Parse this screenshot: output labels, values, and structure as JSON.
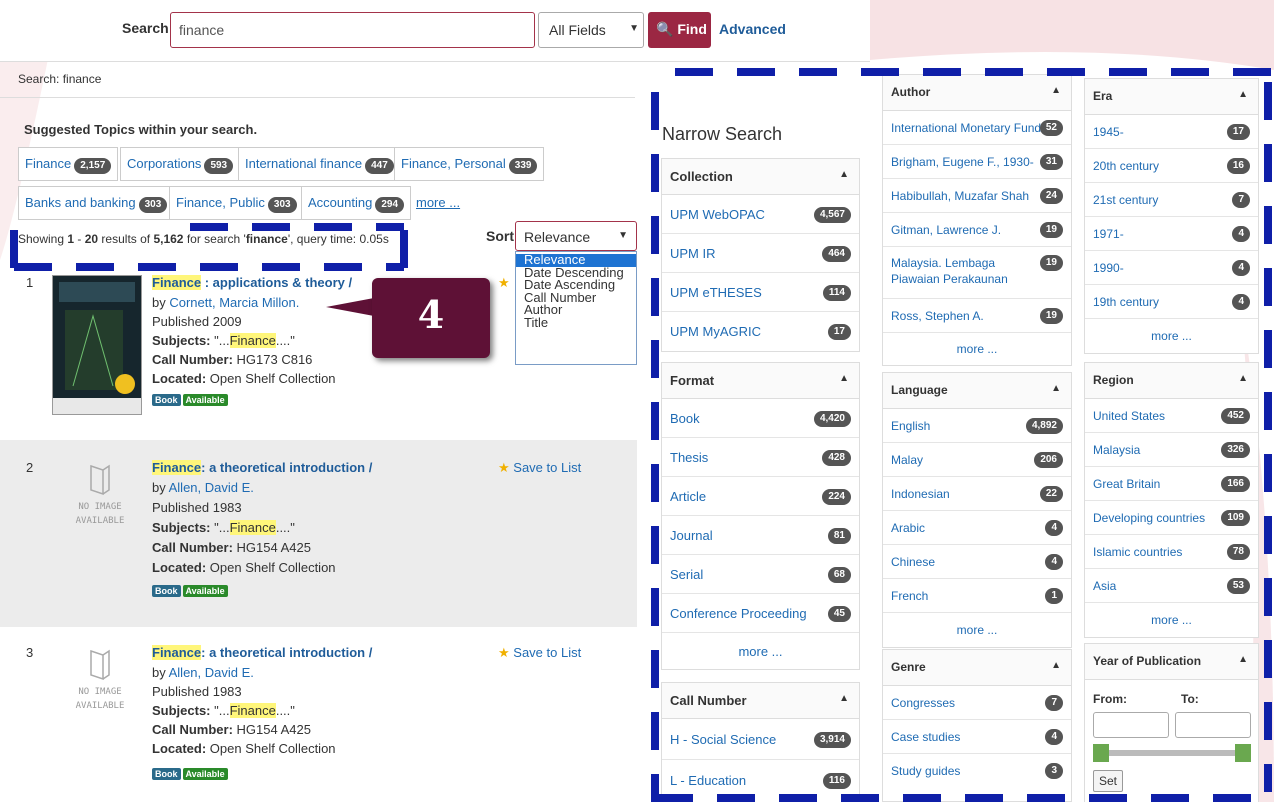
{
  "search": {
    "label": "Search:",
    "value": "finance",
    "field": "All Fields",
    "find": "Find",
    "advanced": "Advanced"
  },
  "breadcrumb": "Search: finance",
  "suggested": {
    "title": "Suggested Topics within your search.",
    "topics": [
      {
        "label": "Finance",
        "count": "2,157"
      },
      {
        "label": "Corporations",
        "count": "593"
      },
      {
        "label": "International finance",
        "count": "447"
      },
      {
        "label": "Finance, Personal",
        "count": "339"
      },
      {
        "label": "Banks and banking",
        "count": "303"
      },
      {
        "label": "Finance, Public",
        "count": "303"
      },
      {
        "label": "Accounting",
        "count": "294"
      }
    ],
    "more": "more ..."
  },
  "showing": {
    "pre": "Showing ",
    "from": "1",
    "mid1": " - ",
    "to": "20",
    "mid2": " results of ",
    "total": "5,162",
    "mid3": " for search '",
    "query": "finance",
    "post": "', query time: 0.05s"
  },
  "sort": {
    "label": "Sort",
    "selected": "Relevance",
    "options": [
      "Relevance",
      "Date Descending",
      "Date Ascending",
      "Call Number",
      "Author",
      "Title"
    ]
  },
  "callout": "4",
  "results": [
    {
      "num": "1",
      "title_hl": "Finance",
      "title_rest": " : applications & theory /",
      "by": "by ",
      "author": "Cornett, Marcia Millon.",
      "published": "Published 2009",
      "subjects_label": "Subjects:",
      "subj_pre": " \"...",
      "subj_hl": "Finance",
      "subj_post": "....\"",
      "call_label": "Call Number:",
      "call": " HG173 C816",
      "loc_label": "Located:",
      "loc": " Open Shelf Collection",
      "tag1": "Book",
      "tag2": "Available",
      "save": ""
    },
    {
      "num": "2",
      "title_hl": "Finance",
      "title_rest": ": a theoretical introduction /",
      "by": "by ",
      "author": "Allen, David E.",
      "published": "Published 1983",
      "subjects_label": "Subjects:",
      "subj_pre": " \"...",
      "subj_hl": "Finance",
      "subj_post": "....\"",
      "call_label": "Call Number:",
      "call": " HG154 A425",
      "loc_label": "Located:",
      "loc": " Open Shelf Collection",
      "tag1": "Book",
      "tag2": "Available",
      "save": "Save to List",
      "noimg": "NO IMAGE AVAILABLE"
    },
    {
      "num": "3",
      "title_hl": "Finance",
      "title_rest": ": a theoretical introduction /",
      "by": "by ",
      "author": "Allen, David E.",
      "published": "Published 1983",
      "subjects_label": "Subjects:",
      "subj_pre": " \"...",
      "subj_hl": "Finance",
      "subj_post": "....\"",
      "call_label": "Call Number:",
      "call": " HG154 A425",
      "loc_label": "Located:",
      "loc": " Open Shelf Collection",
      "tag1": "Book",
      "tag2": "Available",
      "save": "Save to List",
      "noimg": "NO IMAGE AVAILABLE"
    }
  ],
  "narrow": "Narrow Search",
  "facets": {
    "collection": {
      "title": "Collection",
      "items": [
        {
          "label": "UPM WebOPAC",
          "count": "4,567"
        },
        {
          "label": "UPM IR",
          "count": "464"
        },
        {
          "label": "UPM eTHESES",
          "count": "114"
        },
        {
          "label": "UPM MyAGRIC",
          "count": "17"
        }
      ]
    },
    "format": {
      "title": "Format",
      "items": [
        {
          "label": "Book",
          "count": "4,420"
        },
        {
          "label": "Thesis",
          "count": "428"
        },
        {
          "label": "Article",
          "count": "224"
        },
        {
          "label": "Journal",
          "count": "81"
        },
        {
          "label": "Serial",
          "count": "68"
        },
        {
          "label": "Conference Proceeding",
          "count": "45"
        }
      ],
      "more": "more ..."
    },
    "callnumber": {
      "title": "Call Number",
      "items": [
        {
          "label": "H - Social Science",
          "count": "3,914"
        },
        {
          "label": "L - Education",
          "count": "116"
        }
      ]
    },
    "author": {
      "title": "Author",
      "items": [
        {
          "label": "International Monetary Fund",
          "count": "52"
        },
        {
          "label": "Brigham, Eugene F., 1930-",
          "count": "31"
        },
        {
          "label": "Habibullah, Muzafar Shah",
          "count": "24"
        },
        {
          "label": "Gitman, Lawrence J.",
          "count": "19"
        },
        {
          "label": "Malaysia. Lembaga Piawaian Perakaunan",
          "count": "19"
        },
        {
          "label": "Ross, Stephen A.",
          "count": "19"
        }
      ],
      "more": "more ..."
    },
    "language": {
      "title": "Language",
      "items": [
        {
          "label": "English",
          "count": "4,892"
        },
        {
          "label": "Malay",
          "count": "206"
        },
        {
          "label": "Indonesian",
          "count": "22"
        },
        {
          "label": "Arabic",
          "count": "4"
        },
        {
          "label": "Chinese",
          "count": "4"
        },
        {
          "label": "French",
          "count": "1"
        }
      ],
      "more": "more ..."
    },
    "genre": {
      "title": "Genre",
      "items": [
        {
          "label": "Congresses",
          "count": "7"
        },
        {
          "label": "Case studies",
          "count": "4"
        },
        {
          "label": "Study guides",
          "count": "3"
        }
      ]
    },
    "era": {
      "title": "Era",
      "items": [
        {
          "label": "1945-",
          "count": "17"
        },
        {
          "label": "20th century",
          "count": "16"
        },
        {
          "label": "21st century",
          "count": "7"
        },
        {
          "label": "1971-",
          "count": "4"
        },
        {
          "label": "1990-",
          "count": "4"
        },
        {
          "label": "19th century",
          "count": "4"
        }
      ],
      "more": "more ..."
    },
    "region": {
      "title": "Region",
      "items": [
        {
          "label": "United States",
          "count": "452"
        },
        {
          "label": "Malaysia",
          "count": "326"
        },
        {
          "label": "Great Britain",
          "count": "166"
        },
        {
          "label": "Developing countries",
          "count": "109"
        },
        {
          "label": "Islamic countries",
          "count": "78"
        },
        {
          "label": "Asia",
          "count": "53"
        }
      ],
      "more": "more ..."
    },
    "year": {
      "title": "Year of Publication",
      "from": "From:",
      "to": "To:",
      "set": "Set"
    }
  },
  "colors": {
    "accent": "#9b2743",
    "link": "#1f6bb3",
    "annotation": "#0f1fa8",
    "callout": "#5e1136"
  }
}
